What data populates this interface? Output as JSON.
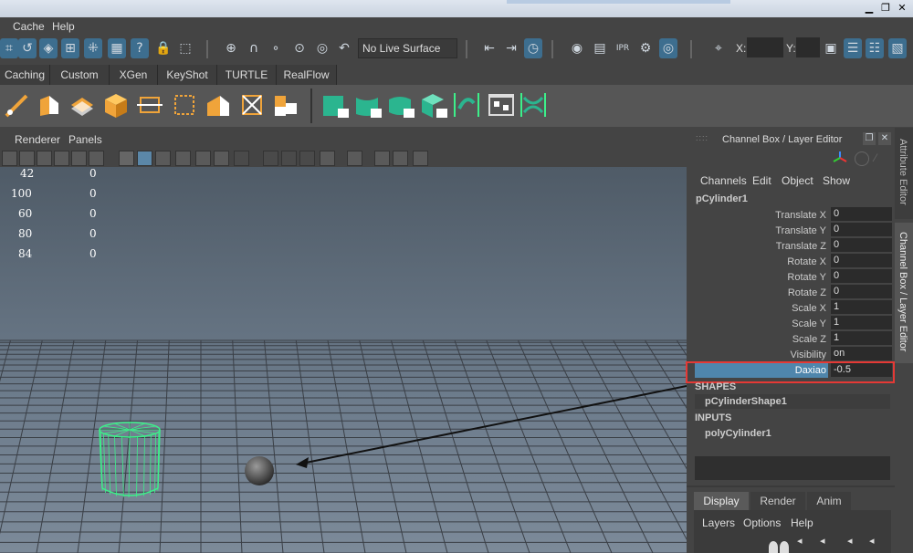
{
  "window": {
    "minimize": "▁",
    "restore": "❐",
    "close": "✕"
  },
  "menubar": {
    "items": [
      "Cache",
      "Help"
    ]
  },
  "statusline": {
    "live_surface": "No Live Surface",
    "x_label": "X:",
    "y_label": "Y:"
  },
  "shelf_tabs": [
    "Caching",
    "Custom",
    "XGen",
    "KeyShot",
    "TURTLE",
    "RealFlow"
  ],
  "panel_menu": {
    "items": [
      "Renderer",
      "Panels"
    ]
  },
  "hud": {
    "rows": [
      {
        "a": "42",
        "b": "0"
      },
      {
        "a": "100",
        "b": "0"
      },
      {
        "a": "60",
        "b": "0"
      },
      {
        "a": "80",
        "b": "0"
      },
      {
        "a": "84",
        "b": "0"
      }
    ]
  },
  "channel_box": {
    "title": "Channel Box / Layer Editor",
    "menu": [
      "Channels",
      "Edit",
      "Object",
      "Show"
    ],
    "object_name": "pCylinder1",
    "channels": [
      {
        "label": "Translate X",
        "value": "0"
      },
      {
        "label": "Translate Y",
        "value": "0"
      },
      {
        "label": "Translate Z",
        "value": "0"
      },
      {
        "label": "Rotate X",
        "value": "0"
      },
      {
        "label": "Rotate Y",
        "value": "0"
      },
      {
        "label": "Rotate Z",
        "value": "0"
      },
      {
        "label": "Scale X",
        "value": "1"
      },
      {
        "label": "Scale Y",
        "value": "1"
      },
      {
        "label": "Scale Z",
        "value": "1"
      },
      {
        "label": "Visibility",
        "value": "on"
      }
    ],
    "custom_attr": {
      "label": "Daxiao",
      "value": "-0.5"
    },
    "shapes_header": "SHAPES",
    "shape_node": "pCylinderShape1",
    "inputs_header": "INPUTS",
    "input_node": "polyCylinder1"
  },
  "layer_editor": {
    "tabs": [
      "Display",
      "Render",
      "Anim"
    ],
    "menu": [
      "Layers",
      "Options",
      "Help"
    ]
  },
  "side_tabs": {
    "attribute_editor": "Attribute Editor",
    "channel_box": "Channel Box / Layer Editor"
  },
  "colors": {
    "highlight_box": "#e53935",
    "selection_blue": "#4f86ac",
    "wire_green": "#3df08a",
    "accent_blue": "#3d6e8f"
  }
}
